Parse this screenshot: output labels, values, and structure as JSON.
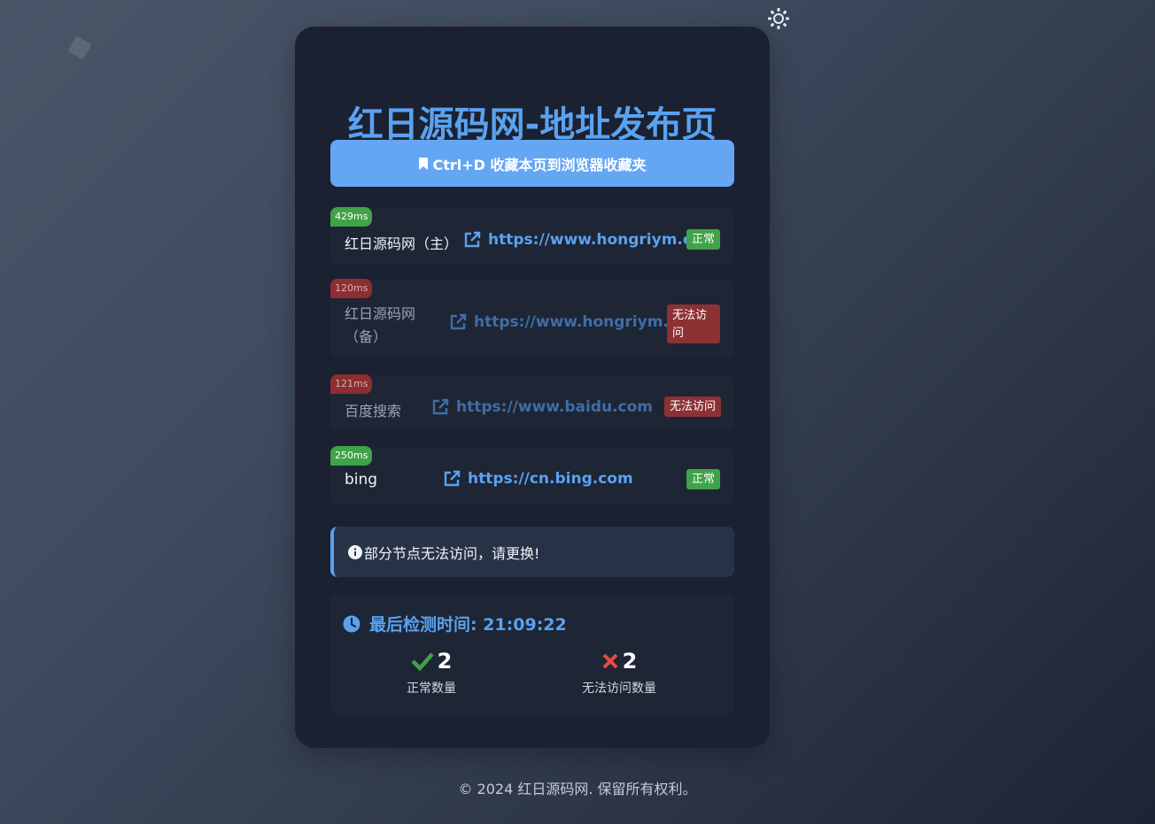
{
  "page": {
    "title": "红日源码网-地址发布页",
    "bookmark_hint": "Ctrl+D 收藏本页到浏览器收藏夹",
    "footer": "© 2024 红日源码网. 保留所有权利。"
  },
  "links": [
    {
      "latency": "429ms",
      "name": "红日源码网（主）",
      "url": "https://www.hongriym.cn",
      "status": "正常",
      "state": "ok"
    },
    {
      "latency": "120ms",
      "name": "红日源码网（备）",
      "url": "https://www.hongriym.cn",
      "status": "无法访问",
      "state": "bad"
    },
    {
      "latency": "121ms",
      "name": "百度搜索",
      "url": "https://www.baidu.com",
      "status": "无法访问",
      "state": "bad"
    },
    {
      "latency": "250ms",
      "name": "bing",
      "url": "https://cn.bing.com",
      "status": "正常",
      "state": "ok"
    }
  ],
  "alert": {
    "text": "部分节点无法访问，请更换!"
  },
  "stats": {
    "last_check_label": "最后检测时间: 21:09:22",
    "ok_count": "2",
    "ok_label": "正常数量",
    "bad_count": "2",
    "bad_label": "无法访问数量"
  },
  "icons": {
    "theme": "sun-icon",
    "bookmark": "bookmark-icon",
    "link": "external-link-icon",
    "info": "info-circle-icon",
    "clock": "clock-icon",
    "check": "check-icon",
    "cross": "cross-icon"
  },
  "colors": {
    "accent": "#5aa2f0",
    "ok": "#3fa347",
    "bad": "#8d2e31",
    "cross": "#e74c3c"
  }
}
